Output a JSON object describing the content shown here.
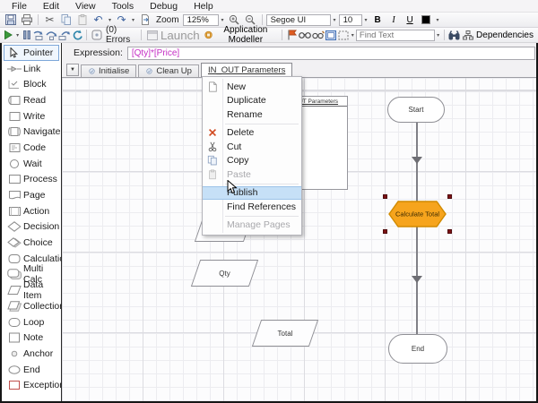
{
  "menu_bar": {
    "items": [
      "File",
      "Edit",
      "View",
      "Tools",
      "Debug",
      "Help"
    ]
  },
  "toolbar": {
    "zoom_label": "Zoom",
    "zoom_value": "125%",
    "font_name": "Segoe UI",
    "font_size": "10",
    "bold_label": "B",
    "italic_label": "I",
    "underline_label": "U",
    "errors_label": "(0) Errors",
    "launch_label": "Launch",
    "app_modeller_label": "Application Modeller",
    "find_text_placeholder": "Find Text",
    "dependencies_label": "Dependencies"
  },
  "expression": {
    "label": "Expression:",
    "value": "[Qty]*[Price]",
    "value_color": "#c42ec4"
  },
  "tabs": [
    {
      "label": "Initialise",
      "icon": "page-icon",
      "active": false
    },
    {
      "label": "Clean Up",
      "icon": "page-icon",
      "active": false
    },
    {
      "label": "IN_OUT Parameters",
      "icon": "",
      "active": true
    }
  ],
  "sidebar": {
    "items": [
      {
        "label": "Pointer",
        "icon": "pointer-icon",
        "selected": true
      },
      {
        "label": "Link",
        "icon": "link-icon"
      },
      {
        "label": "Block",
        "icon": "block-icon"
      },
      {
        "label": "Read",
        "icon": "read-icon"
      },
      {
        "label": "Write",
        "icon": "write-icon"
      },
      {
        "label": "Navigate",
        "icon": "navigate-icon"
      },
      {
        "label": "Code",
        "icon": "code-icon"
      },
      {
        "label": "Wait",
        "icon": "wait-icon"
      },
      {
        "label": "Process",
        "icon": "process-icon"
      },
      {
        "label": "Page",
        "icon": "page-shape-icon"
      },
      {
        "label": "Action",
        "icon": "action-icon"
      },
      {
        "label": "Decision",
        "icon": "decision-icon"
      },
      {
        "label": "Choice",
        "icon": "choice-icon"
      },
      {
        "label": "Calculation",
        "icon": "calculation-icon"
      },
      {
        "label": "Multi Calc",
        "icon": "multi-calc-icon"
      },
      {
        "label": "Data Item",
        "icon": "data-item-icon"
      },
      {
        "label": "Collection",
        "icon": "collection-icon"
      },
      {
        "label": "Loop",
        "icon": "loop-icon"
      },
      {
        "label": "Note",
        "icon": "note-icon"
      },
      {
        "label": "Anchor",
        "icon": "anchor-icon"
      },
      {
        "label": "End",
        "icon": "end-icon"
      },
      {
        "label": "Exception",
        "icon": "exception-icon"
      }
    ]
  },
  "context_menu": {
    "items": [
      {
        "label": "New",
        "icon": "new-document-icon"
      },
      {
        "label": "Duplicate"
      },
      {
        "label": "Rename"
      },
      {
        "type": "separator"
      },
      {
        "label": "Delete",
        "icon": "delete-icon"
      },
      {
        "label": "Cut",
        "icon": "cut-icon"
      },
      {
        "label": "Copy",
        "icon": "copy-icon"
      },
      {
        "label": "Paste",
        "icon": "paste-icon",
        "disabled": true
      },
      {
        "type": "separator"
      },
      {
        "label": "Publish",
        "highlighted": true
      },
      {
        "label": "Find References"
      },
      {
        "type": "separator"
      },
      {
        "label": "Manage Pages",
        "disabled": true
      }
    ]
  },
  "canvas": {
    "nodes": {
      "start": {
        "label": "Start"
      },
      "calculate": {
        "label": "Calculate Total",
        "fill": "#F6A41D",
        "stroke": "#D18A00"
      },
      "end": {
        "label": "End"
      },
      "qty": {
        "label": "Qty"
      },
      "total": {
        "label": "Total"
      },
      "params_box": {
        "label": "IN_OUT Parameters"
      }
    }
  }
}
